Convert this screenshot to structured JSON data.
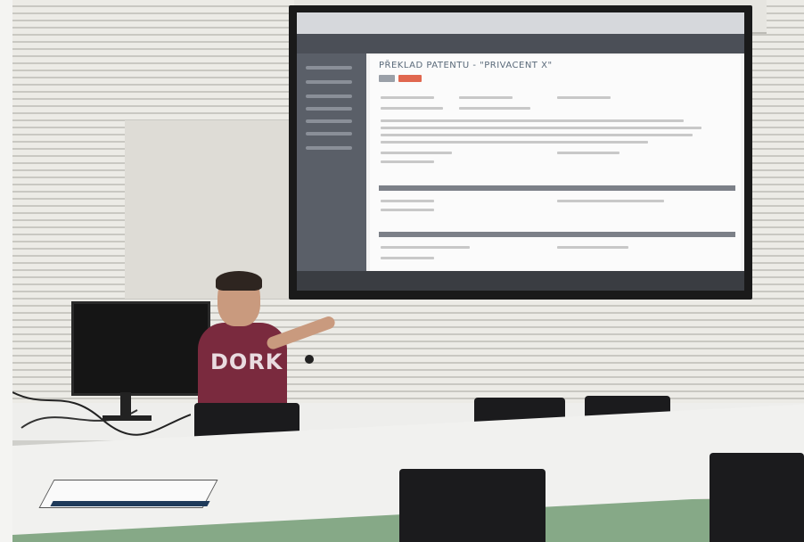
{
  "scene": {
    "description_tags": [
      "lecture-room",
      "projector-screen",
      "presenter",
      "monitor",
      "chairs",
      "tables",
      "book"
    ]
  },
  "projected_app": {
    "page_title": "PŘEKLAD PATENTU - \"PRIVACENT X\"",
    "colors": {
      "header": "#4b4f57",
      "sidebar": "#5a5f68",
      "accent_button": "#e0674f",
      "section_bar": "#7c8088"
    }
  },
  "shirt": {
    "print_text": "DORK"
  }
}
